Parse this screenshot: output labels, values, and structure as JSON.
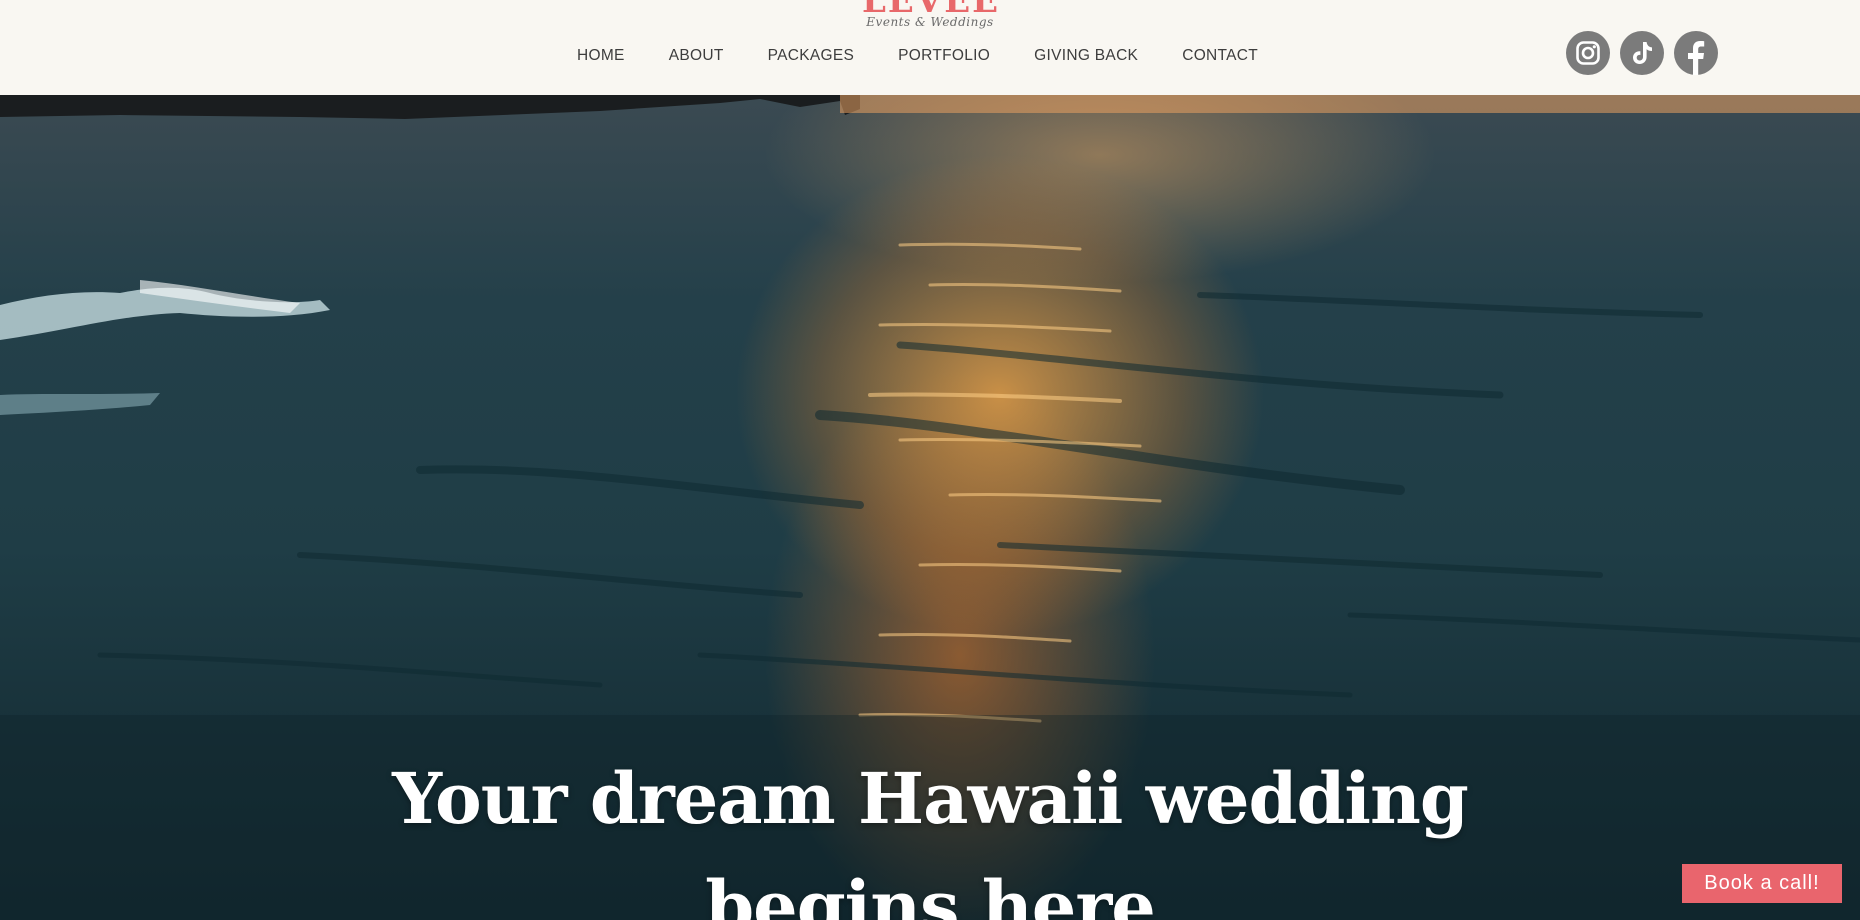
{
  "logo": {
    "word": "LEVEE",
    "tagline": "Events & Weddings"
  },
  "nav": {
    "items": [
      {
        "label": "HOME"
      },
      {
        "label": "ABOUT"
      },
      {
        "label": "PACKAGES"
      },
      {
        "label": "PORTFOLIO"
      },
      {
        "label": "GIVING BACK"
      },
      {
        "label": "CONTACT"
      }
    ]
  },
  "socials": [
    {
      "icon": "instagram-icon"
    },
    {
      "icon": "tiktok-icon"
    },
    {
      "icon": "facebook-icon"
    }
  ],
  "hero": {
    "image": "aerial ocean sunset with waves",
    "title_line1": "Your dream Hawaii wedding",
    "title_line2": "begins here"
  },
  "cta": {
    "book_label": "Book a call!"
  },
  "colors": {
    "header_bg": "#f9f7f2",
    "brand_coral": "#e8686a",
    "social_grey": "#7b7b7b",
    "cta_bg": "#e9656d",
    "nav_text": "#3d3d3d"
  }
}
